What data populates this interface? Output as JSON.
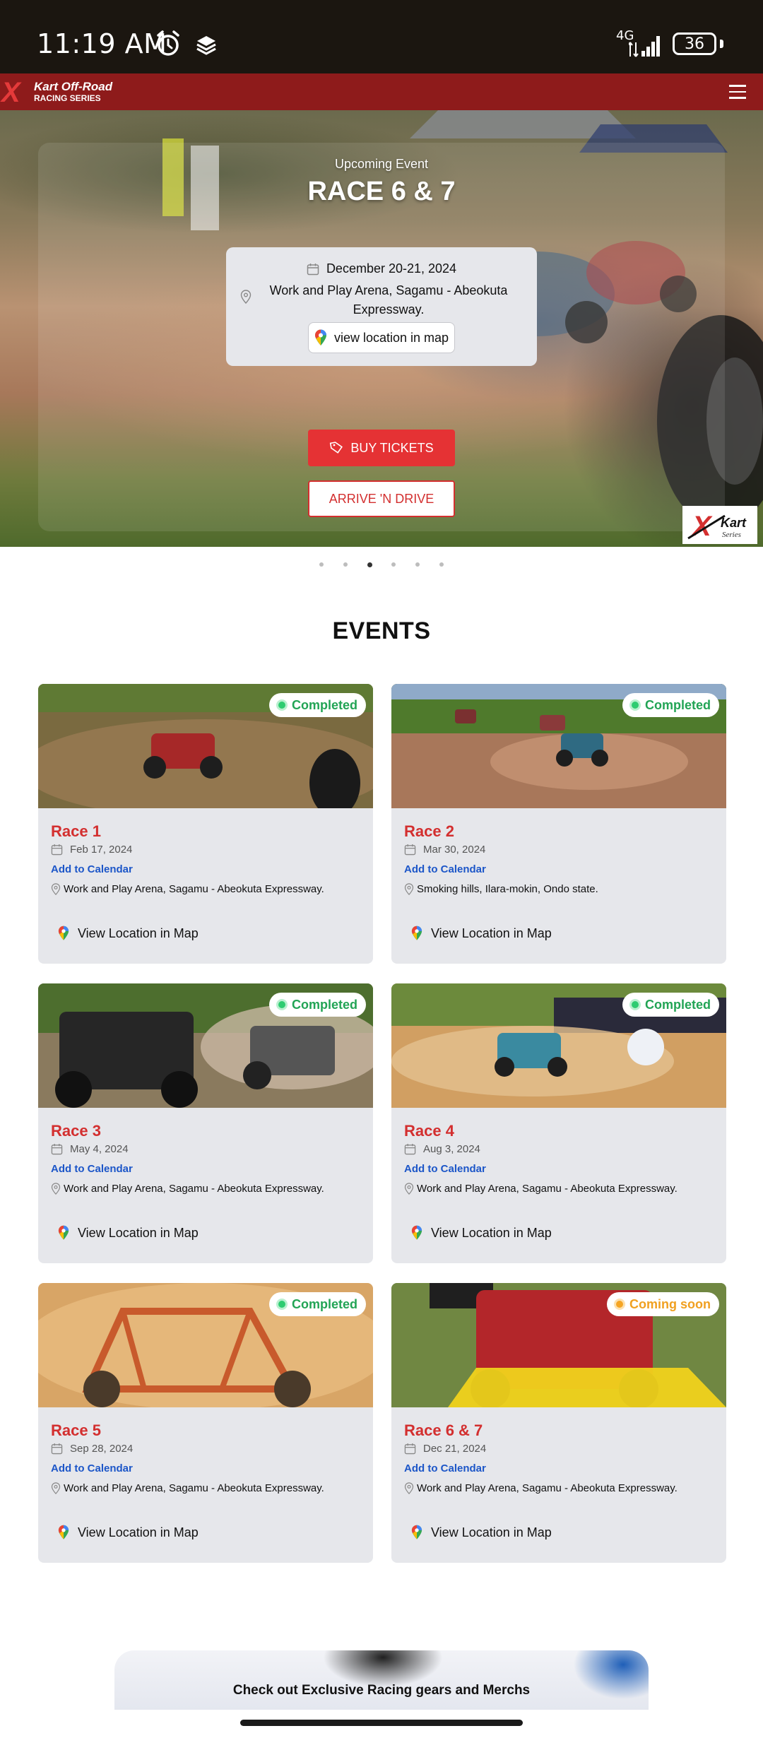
{
  "status_bar": {
    "time": "11:19 AM",
    "network": "4G",
    "battery": "36",
    "icons": [
      "alarm-icon",
      "layers-icon",
      "signal-icon",
      "battery-icon"
    ]
  },
  "nav": {
    "logo_line1": "Kart Off-Road",
    "logo_line2": "RACING SERIES",
    "menu_icon": "hamburger-menu-icon"
  },
  "hero": {
    "eyebrow": "Upcoming Event",
    "title": "RACE 6 & 7",
    "date": "December 20-21, 2024",
    "venue": "Work and Play Arena, Sagamu - Abeokuta Expressway.",
    "map_button": "view location in map",
    "buy_button": "BUY TICKETS",
    "arrive_button": "ARRIVE 'N DRIVE",
    "corner_logo": "Kart Series",
    "slide_count": 6,
    "active_slide": 3
  },
  "events": {
    "title": "EVENTS",
    "items": [
      {
        "name": "Race 1",
        "date": "Feb 17, 2024",
        "add_to_calendar": "Add to Calendar",
        "location": "Work and Play Arena, Sagamu - Abeokuta Expressway.",
        "map_link": "View Location in Map",
        "status": "Completed"
      },
      {
        "name": "Race 2",
        "date": "Mar 30, 2024",
        "add_to_calendar": "Add to Calendar",
        "location": "Smoking hills, Ilara-mokin, Ondo state.",
        "map_link": "View Location in Map",
        "status": "Completed"
      },
      {
        "name": "Race 3",
        "date": "May 4, 2024",
        "add_to_calendar": "Add to Calendar",
        "location": "Work and Play Arena, Sagamu - Abeokuta Expressway.",
        "map_link": "View Location in Map",
        "status": "Completed"
      },
      {
        "name": "Race 4",
        "date": "Aug 3, 2024",
        "add_to_calendar": "Add to Calendar",
        "location": "Work and Play Arena, Sagamu - Abeokuta Expressway.",
        "map_link": "View Location in Map",
        "status": "Completed"
      },
      {
        "name": "Race 5",
        "date": "Sep 28, 2024",
        "add_to_calendar": "Add to Calendar",
        "location": "Work and Play Arena, Sagamu - Abeokuta Expressway.",
        "map_link": "View Location in Map",
        "status": "Completed"
      },
      {
        "name": "Race 6 & 7",
        "date": "Dec 21, 2024",
        "add_to_calendar": "Add to Calendar",
        "location": "Work and Play Arena, Sagamu - Abeokuta Expressway.",
        "map_link": "View Location in Map",
        "status": "Coming soon"
      }
    ]
  },
  "merch": {
    "heading": "Check out Exclusive Racing gears and Merchs"
  },
  "colors": {
    "brand_red": "#8e1b1b",
    "button_red": "#e53234",
    "title_red": "#d32f2f",
    "link_blue": "#1c56c8",
    "completed_green": "#22a455",
    "soon_orange": "#f0a020",
    "card_bg": "#e6e7eb"
  }
}
